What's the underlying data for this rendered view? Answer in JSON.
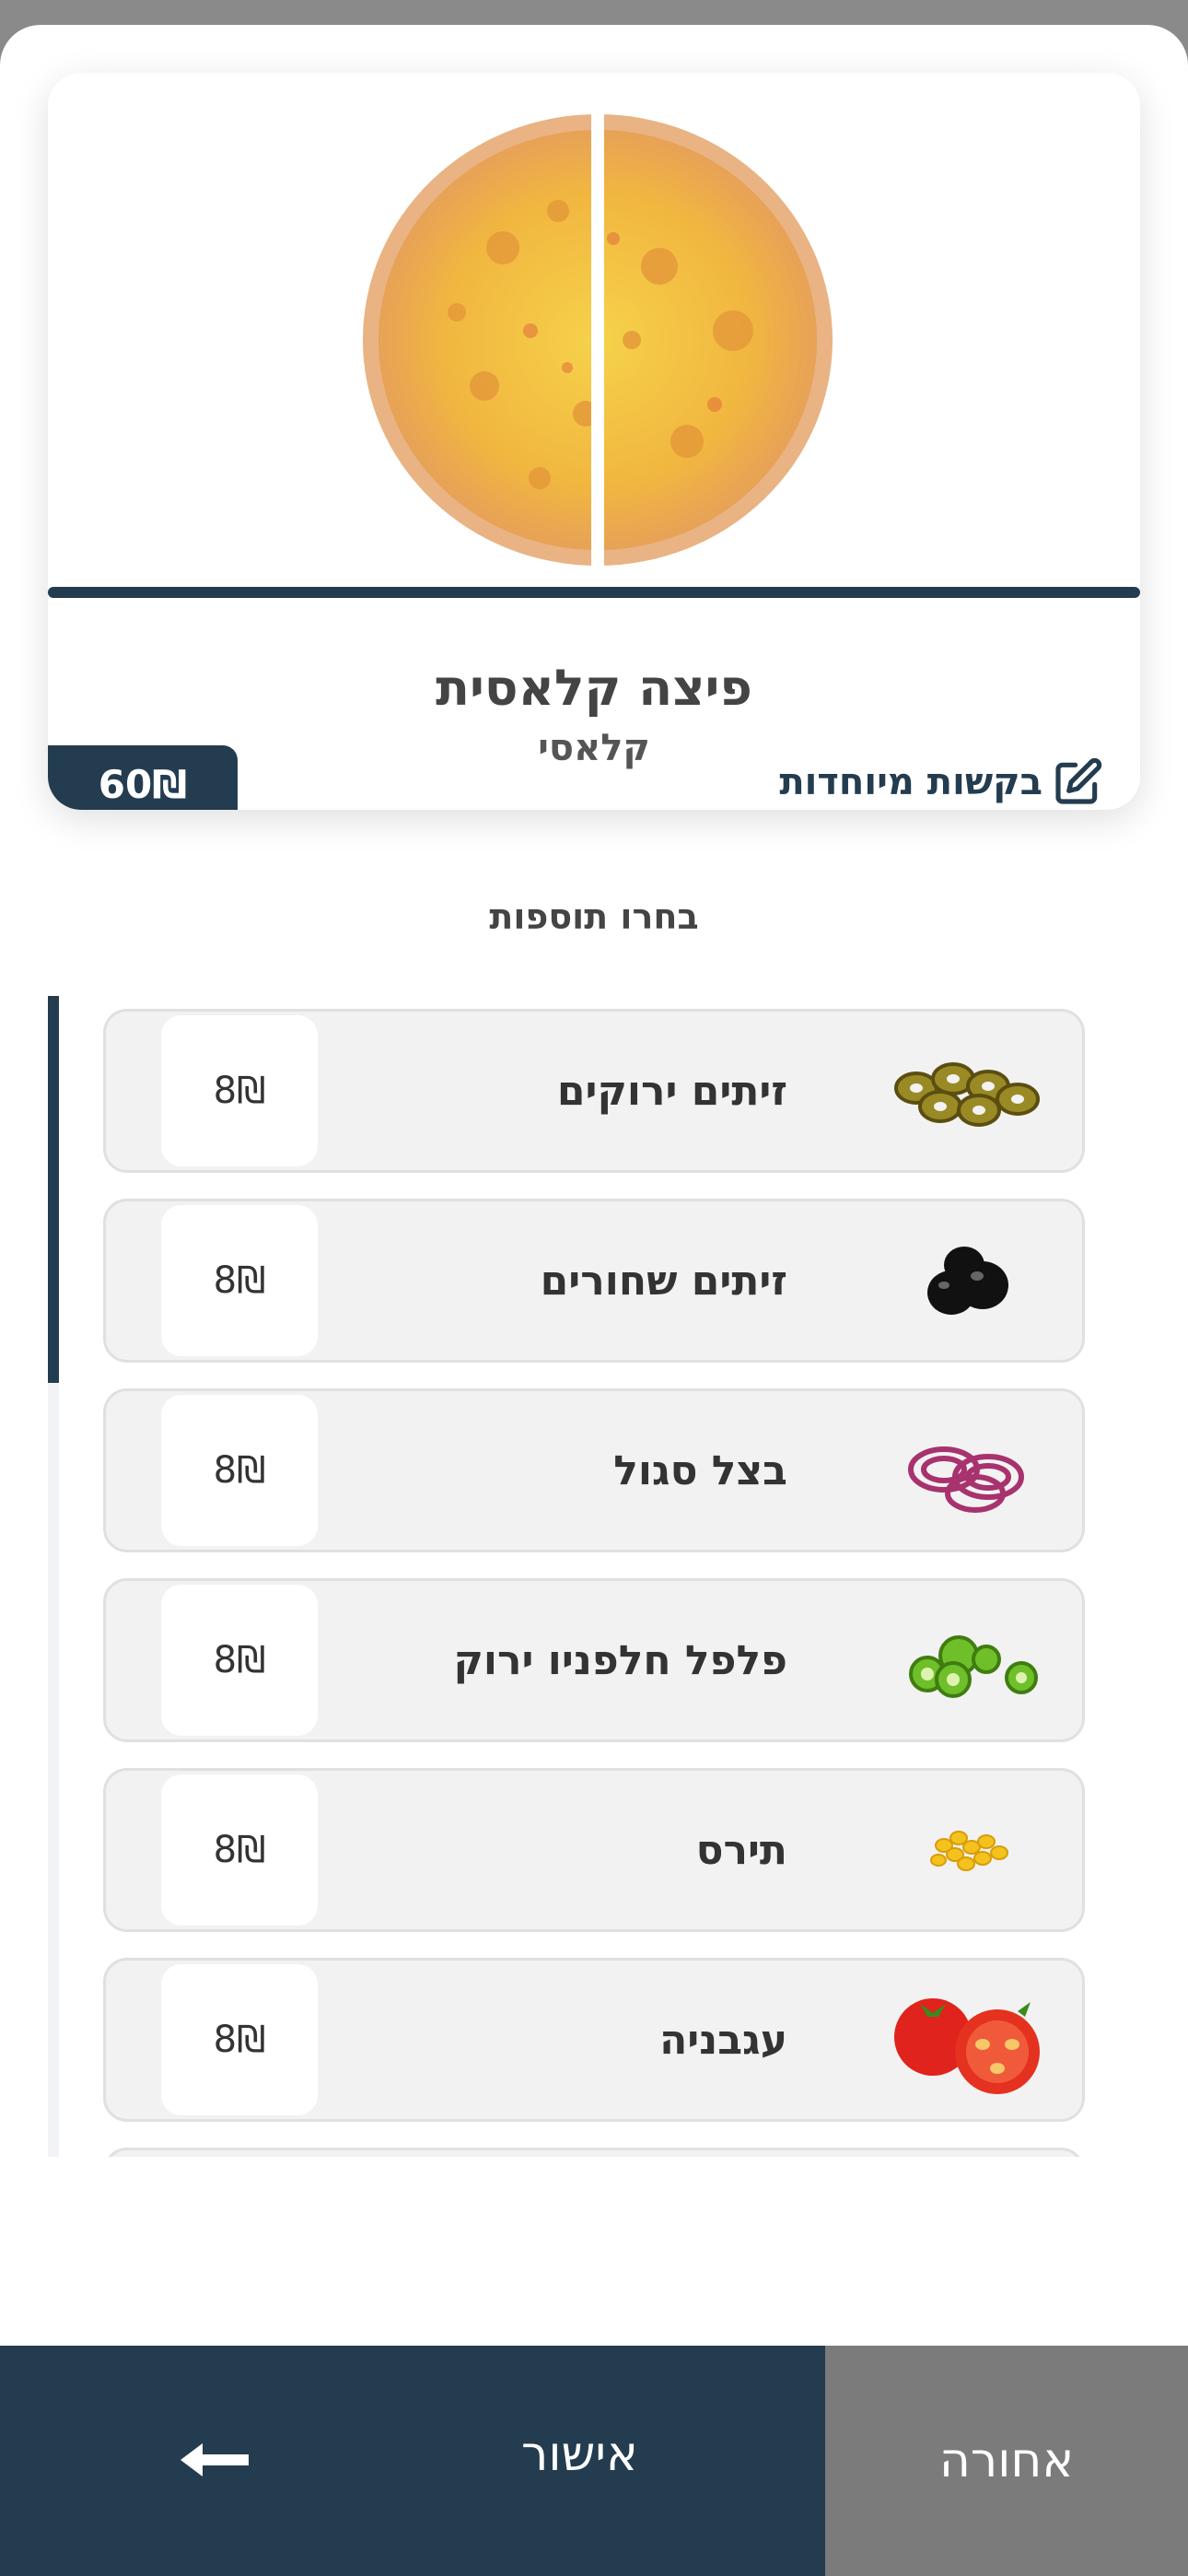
{
  "product": {
    "name": "פיצה קלאסית",
    "subtitle": "קלאסי",
    "price": "60₪",
    "special_requests": "בקשות מיוחדות"
  },
  "addons": {
    "title": "בחרו תוספות",
    "items": [
      {
        "label": "זיתים ירוקים",
        "price": "8₪",
        "icon": "green-olives-icon"
      },
      {
        "label": "זיתים שחורים",
        "price": "8₪",
        "icon": "black-olives-icon"
      },
      {
        "label": "בצל סגול",
        "price": "8₪",
        "icon": "red-onion-icon"
      },
      {
        "label": "פלפל חלפניו ירוק",
        "price": "8₪",
        "icon": "jalapeno-icon"
      },
      {
        "label": "תירס",
        "price": "8₪",
        "icon": "corn-icon"
      },
      {
        "label": "עגבניה",
        "price": "8₪",
        "icon": "tomato-icon"
      }
    ]
  },
  "footer": {
    "confirm_label": "אישור",
    "back_label": "אחורה"
  },
  "colors": {
    "primary": "#233c50",
    "back_button": "#7b7b7b",
    "item_bg": "#f2f2f2"
  }
}
